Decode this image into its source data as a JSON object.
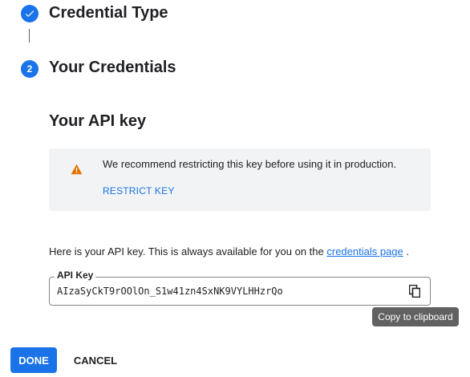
{
  "steps": [
    {
      "number": "",
      "title": "Credential Type",
      "state": "completed",
      "icon": "check-icon"
    },
    {
      "number": "2",
      "title": "Your Credentials",
      "state": "active"
    }
  ],
  "api_key_section": {
    "heading": "Your API key",
    "warning": {
      "icon": "warning-icon",
      "message": "We recommend restricting this key before using it in production.",
      "action_label": "RESTRICT KEY"
    },
    "info": {
      "text_before": "Here is your API key. This is always available for you on the ",
      "link_label": "credentials page",
      "text_after": " ."
    },
    "key_field": {
      "label": "API Key",
      "value": "AIzaSyCkT9rOOlOn_S1w41zn4SxNK9VYLHHzrQo",
      "copy_icon": "copy-icon"
    },
    "tooltip": "Copy to clipboard"
  },
  "actions": {
    "done_label": "DONE",
    "cancel_label": "CANCEL"
  },
  "colors": {
    "accent": "#1a73e8",
    "warning": "#e37400",
    "panel": "#f1f3f4",
    "tooltip": "#616161"
  }
}
